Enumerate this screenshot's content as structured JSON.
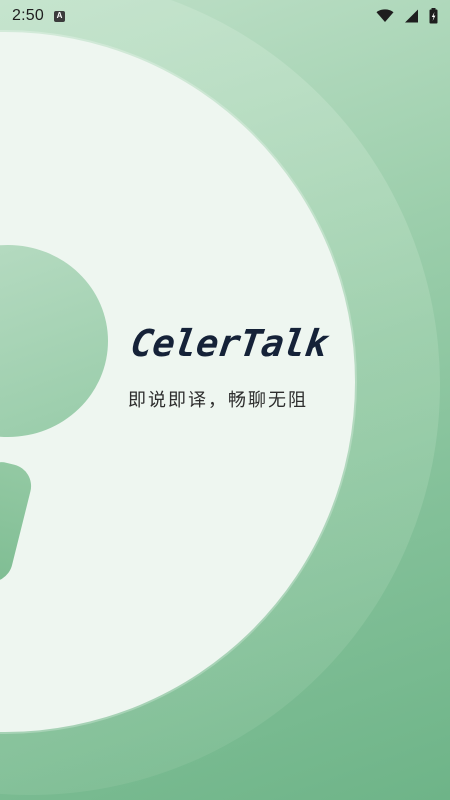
{
  "status_bar": {
    "time": "2:50",
    "notification_icon": "a-icon",
    "icons": [
      "wifi-icon",
      "signal-icon",
      "battery-icon"
    ]
  },
  "splash": {
    "app_name": "CelerTalk",
    "tagline": "即说即译，畅聊无阻"
  },
  "colors": {
    "background_top": "#bfe0c8",
    "background_bottom": "#6eb488",
    "disc": "#eef6f0",
    "logo_text": "#152238",
    "tagline_text": "#2d2d2d"
  }
}
